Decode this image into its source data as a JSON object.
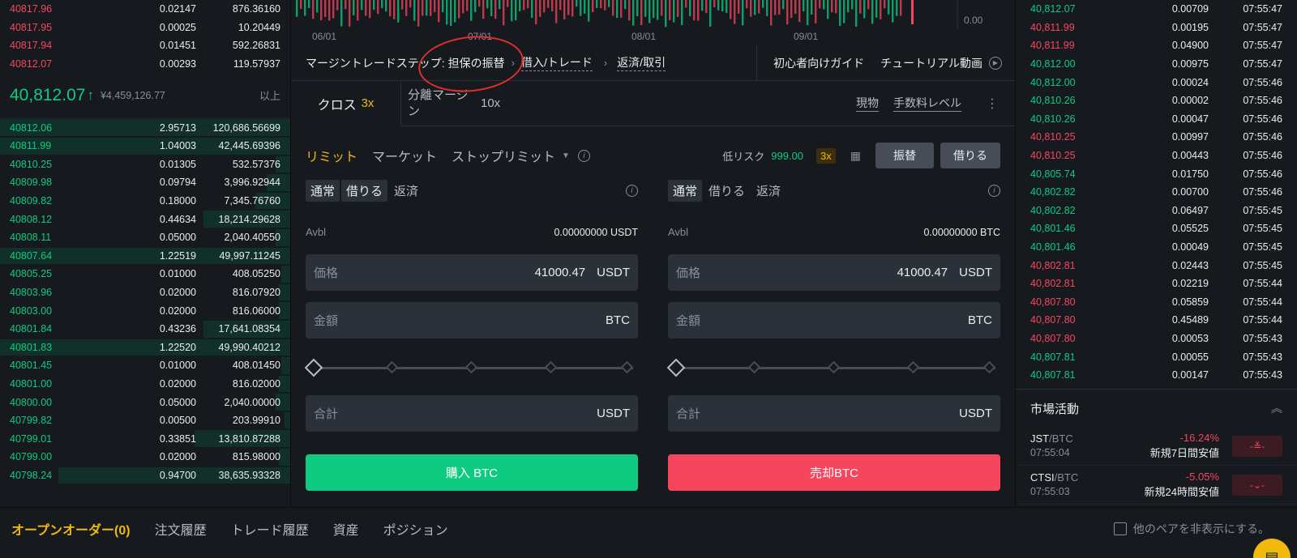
{
  "orderbook": {
    "asks": [
      {
        "price": "40817.96",
        "qty": "0.02147",
        "total": "876.36160"
      },
      {
        "price": "40817.95",
        "qty": "0.00025",
        "total": "10.20449"
      },
      {
        "price": "40817.94",
        "qty": "0.01451",
        "total": "592.26831"
      },
      {
        "price": "40812.07",
        "qty": "0.00293",
        "total": "119.57937"
      }
    ],
    "last_price": "40,812.07",
    "last_arrow": "↑",
    "last_fiat": "¥4,459,126.77",
    "more_label": "以上",
    "bids": [
      {
        "price": "40812.06",
        "qty": "2.95713",
        "total": "120,686.56699",
        "depth": 1.0
      },
      {
        "price": "40811.99",
        "qty": "1.04003",
        "total": "42,445.69396",
        "depth": 1.0
      },
      {
        "price": "40810.25",
        "qty": "0.01305",
        "total": "532.57376",
        "depth": 0.05
      },
      {
        "price": "40809.98",
        "qty": "0.09794",
        "total": "3,996.92944",
        "depth": 0.08
      },
      {
        "price": "40809.82",
        "qty": "0.18000",
        "total": "7,345.76760",
        "depth": 0.12
      },
      {
        "price": "40808.12",
        "qty": "0.44634",
        "total": "18,214.29628",
        "depth": 0.3
      },
      {
        "price": "40808.11",
        "qty": "0.05000",
        "total": "2,040.40550",
        "depth": 0.05
      },
      {
        "price": "40807.64",
        "qty": "1.22519",
        "total": "49,997.11245",
        "depth": 1.0
      },
      {
        "price": "40805.25",
        "qty": "0.01000",
        "total": "408.05250",
        "depth": 0.03
      },
      {
        "price": "40803.96",
        "qty": "0.02000",
        "total": "816.07920",
        "depth": 0.04
      },
      {
        "price": "40803.00",
        "qty": "0.02000",
        "total": "816.06000",
        "depth": 0.04
      },
      {
        "price": "40801.84",
        "qty": "0.43236",
        "total": "17,641.08354",
        "depth": 0.3
      },
      {
        "price": "40801.83",
        "qty": "1.22520",
        "total": "49,990.40212",
        "depth": 1.0
      },
      {
        "price": "40801.45",
        "qty": "0.01000",
        "total": "408.01450",
        "depth": 0.03
      },
      {
        "price": "40801.00",
        "qty": "0.02000",
        "total": "816.02000",
        "depth": 0.04
      },
      {
        "price": "40800.00",
        "qty": "0.05000",
        "total": "2,040.00000",
        "depth": 0.05
      },
      {
        "price": "40799.82",
        "qty": "0.00500",
        "total": "203.99910",
        "depth": 0.02
      },
      {
        "price": "40799.01",
        "qty": "0.33851",
        "total": "13,810.87288",
        "depth": 0.33
      },
      {
        "price": "40799.00",
        "qty": "0.02000",
        "total": "815.98000",
        "depth": 0.04
      },
      {
        "price": "40798.24",
        "qty": "0.94700",
        "total": "38,635.93328",
        "depth": 0.8
      }
    ]
  },
  "chart": {
    "dates": [
      "06/01",
      "07/01",
      "08/01",
      "09/01"
    ],
    "yval": "0.00"
  },
  "steps": {
    "label": "マージントレードステップ:",
    "step1": "担保の振替",
    "step2": "借入/トレード",
    "step3": "返済/取引",
    "guide": "初心者向けガイド",
    "tutorial": "チュートリアル動画"
  },
  "margin_tabs": {
    "cross": "クロス",
    "cross_lev": "3x",
    "isolated": "分離マージン",
    "isolated_lev": "10x",
    "spot": "現物",
    "fee": "手数料レベル"
  },
  "order_types": {
    "limit": "リミット",
    "market": "マーケット",
    "stop_limit": "ストップリミット",
    "risk_label": "低リスク",
    "risk_value": "999.00",
    "lev": "3x",
    "transfer": "振替",
    "borrow": "借りる"
  },
  "buy_form": {
    "mode_normal": "通常",
    "mode_borrow": "借りる",
    "mode_repay": "返済",
    "avbl_label": "Avbl",
    "avbl_value": "0.00000000 USDT",
    "price_label": "価格",
    "price_value": "41000.47",
    "price_unit": "USDT",
    "amount_label": "金額",
    "amount_unit": "BTC",
    "total_label": "合計",
    "total_unit": "USDT",
    "button": "購入 BTC"
  },
  "sell_form": {
    "mode_normal": "通常",
    "mode_borrow": "借りる",
    "mode_repay": "返済",
    "avbl_label": "Avbl",
    "avbl_value": "0.00000000 BTC",
    "price_label": "価格",
    "price_value": "41000.47",
    "price_unit": "USDT",
    "amount_label": "金額",
    "amount_unit": "BTC",
    "total_label": "合計",
    "total_unit": "USDT",
    "button": "売却BTC"
  },
  "trades": [
    {
      "price": "40,812.07",
      "qty": "0.00709",
      "time": "07:55:47",
      "side": "buy"
    },
    {
      "price": "40,811.99",
      "qty": "0.00195",
      "time": "07:55:47",
      "side": "sell"
    },
    {
      "price": "40,811.99",
      "qty": "0.04900",
      "time": "07:55:47",
      "side": "sell"
    },
    {
      "price": "40,812.00",
      "qty": "0.00975",
      "time": "07:55:47",
      "side": "buy"
    },
    {
      "price": "40,812.00",
      "qty": "0.00024",
      "time": "07:55:46",
      "side": "buy"
    },
    {
      "price": "40,810.26",
      "qty": "0.00002",
      "time": "07:55:46",
      "side": "buy"
    },
    {
      "price": "40,810.26",
      "qty": "0.00047",
      "time": "07:55:46",
      "side": "buy"
    },
    {
      "price": "40,810.25",
      "qty": "0.00997",
      "time": "07:55:46",
      "side": "sell"
    },
    {
      "price": "40,810.25",
      "qty": "0.00443",
      "time": "07:55:46",
      "side": "sell"
    },
    {
      "price": "40,805.74",
      "qty": "0.01750",
      "time": "07:55:46",
      "side": "buy"
    },
    {
      "price": "40,802.82",
      "qty": "0.00700",
      "time": "07:55:46",
      "side": "buy"
    },
    {
      "price": "40,802.82",
      "qty": "0.06497",
      "time": "07:55:45",
      "side": "buy"
    },
    {
      "price": "40,801.46",
      "qty": "0.05525",
      "time": "07:55:45",
      "side": "buy"
    },
    {
      "price": "40,801.46",
      "qty": "0.00049",
      "time": "07:55:45",
      "side": "buy"
    },
    {
      "price": "40,802.81",
      "qty": "0.02443",
      "time": "07:55:45",
      "side": "sell"
    },
    {
      "price": "40,802.81",
      "qty": "0.02219",
      "time": "07:55:44",
      "side": "sell"
    },
    {
      "price": "40,807.80",
      "qty": "0.05859",
      "time": "07:55:44",
      "side": "sell"
    },
    {
      "price": "40,807.80",
      "qty": "0.45489",
      "time": "07:55:44",
      "side": "sell"
    },
    {
      "price": "40,807.80",
      "qty": "0.00053",
      "time": "07:55:43",
      "side": "sell"
    },
    {
      "price": "40,807.81",
      "qty": "0.00055",
      "time": "07:55:43",
      "side": "buy"
    },
    {
      "price": "40,807.81",
      "qty": "0.00147",
      "time": "07:55:43",
      "side": "buy"
    }
  ],
  "market_activity": {
    "title": "市場活動",
    "items": [
      {
        "base": "JST",
        "quote": "/BTC",
        "time": "07:55:04",
        "pct": "-16.24%",
        "desc": "新規7日間安値",
        "badge": "-≚-"
      },
      {
        "base": "CTSI",
        "quote": "/BTC",
        "time": "07:55:03",
        "pct": "-5.05%",
        "desc": "新規24時間安値",
        "badge": "-⌄-"
      }
    ]
  },
  "bottom": {
    "tabs": [
      "オープンオーダー(0)",
      "注文履歴",
      "トレード履歴",
      "資産",
      "ポジション"
    ],
    "hide_pairs": "他のペアを非表示にする。"
  },
  "colors": {
    "buy": "#0ecb81",
    "sell": "#f6465d",
    "accent": "#f0b90b",
    "annotation": "#e02d2d"
  }
}
